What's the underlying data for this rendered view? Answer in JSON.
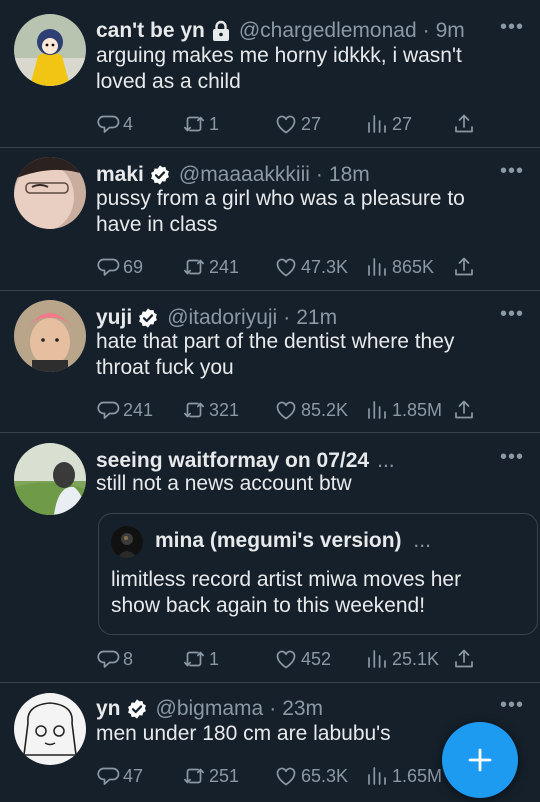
{
  "colors": {
    "background": "#15202b",
    "divider": "#38444d",
    "primary_text": "#e7e9ea",
    "secondary_text": "#8b98a5",
    "accent": "#1d9bf0"
  },
  "tweets": [
    {
      "name": "can't be yn",
      "badge": "lock-icon",
      "handle": "@chargedlemonad",
      "time": "9m",
      "text": "arguing makes me horny idkkk, i wasn't loved as a child",
      "replies": "4",
      "retweets": "1",
      "likes": "27",
      "views": "27"
    },
    {
      "name": "maki",
      "badge": "verified-icon",
      "handle": "@maaaakkkiii",
      "time": "18m",
      "text": "pussy from a girl who was a pleasure to have in class",
      "replies": "69",
      "retweets": "241",
      "likes": "47.3K",
      "views": "865K"
    },
    {
      "name": "yuji",
      "badge": "verified-icon",
      "handle": "@itadoriyuji",
      "time": "21m",
      "text": "hate that part of the dentist where they throat fuck you",
      "replies": "241",
      "retweets": "321",
      "likes": "85.2K",
      "views": "1.85M"
    },
    {
      "name": "seeing waitformay on 07/24",
      "name_trail": "...",
      "text": "still not a news account btw",
      "quote": {
        "name": "mina (megumi's version)",
        "name_trail": "...",
        "text": "limitless record artist miwa moves her show back again to this weekend!"
      },
      "replies": "8",
      "retweets": "1",
      "likes": "452",
      "views": "25.1K"
    },
    {
      "name": "yn",
      "badge": "verified-icon",
      "handle": "@bigmama",
      "time": "23m",
      "text": "men under 180 cm are labubu's",
      "replies": "47",
      "retweets": "251",
      "likes": "65.3K",
      "views": "1.65M"
    }
  ],
  "fab": {
    "icon": "plus-icon",
    "label": "+"
  }
}
